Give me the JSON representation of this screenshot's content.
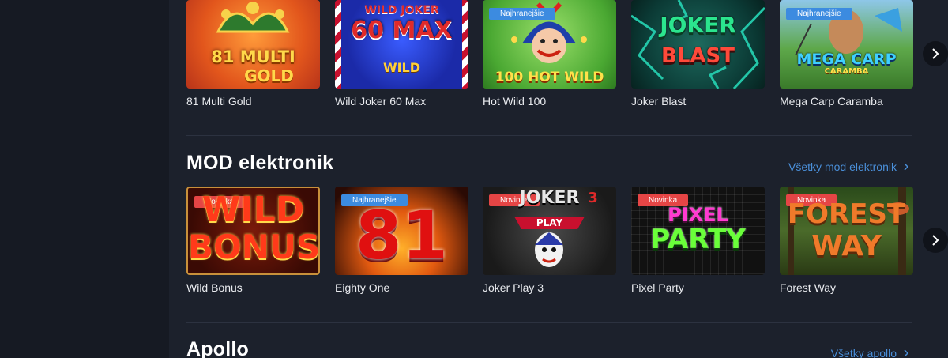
{
  "row1": {
    "games": [
      {
        "label": "81 Multi Gold",
        "art_line1": "81 MULTI",
        "art_line2": "GOLD",
        "badge": ""
      },
      {
        "label": "Wild Joker 60 Max",
        "art_line1": "WILD JOKER",
        "art_line2": "60 MAX",
        "art_line3": "WILD",
        "badge": ""
      },
      {
        "label": "Hot Wild 100",
        "art_line1": "100 HOT WILD",
        "badge": "Najhranejšie"
      },
      {
        "label": "Joker Blast",
        "art_line1": "JOKER",
        "art_line2": "BLAST",
        "badge": ""
      },
      {
        "label": "Mega Carp Caramba",
        "art_line1": "MEGA CARP",
        "art_line2": "CARAMBA",
        "badge": "Najhranejšie"
      }
    ]
  },
  "mod": {
    "title": "MOD elektronik",
    "link": "Všetky mod elektronik",
    "games": [
      {
        "label": "Wild Bonus",
        "art_line1": "WILD",
        "art_line2": "BONUS",
        "badge": "Novinka"
      },
      {
        "label": "Eighty One",
        "art_line1": "81",
        "badge": "Najhranejšie"
      },
      {
        "label": "Joker Play 3",
        "art_line1": "JOKER",
        "art_line2": "PLAY",
        "art_line3": "3",
        "badge": "Novinka"
      },
      {
        "label": "Pixel Party",
        "art_line1": "PIXEL",
        "art_line2": "PARTY",
        "badge": "Novinka"
      },
      {
        "label": "Forest Way",
        "art_line1": "FOREST",
        "art_line2": "WAY",
        "badge": "Novinka"
      }
    ]
  },
  "apollo": {
    "title": "Apollo",
    "link": "Všetky apollo"
  },
  "colors": {
    "background": "#151820",
    "panel": "#1c212c",
    "link": "#4a8fd9",
    "badge_blue": "#3c8be0",
    "badge_red": "#e54545"
  },
  "icons": {
    "next": "chevron-right-icon",
    "link_arrow": "chevron-right-icon"
  }
}
